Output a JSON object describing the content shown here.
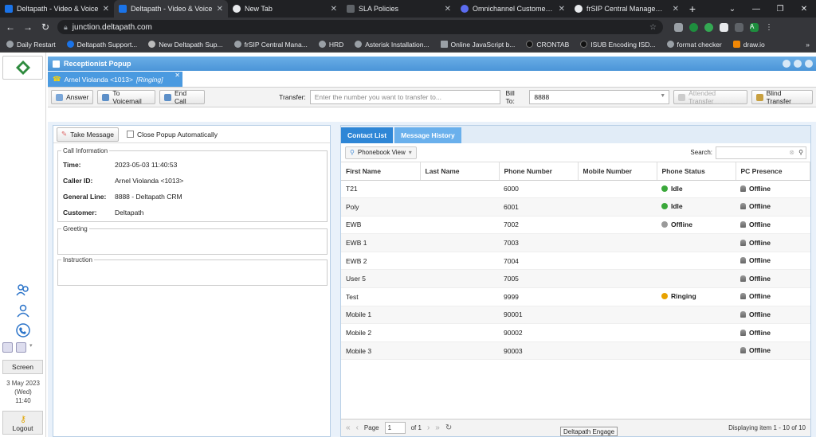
{
  "browser": {
    "tabs": [
      {
        "title": "Deltapath - Video & Voice",
        "active": false
      },
      {
        "title": "Deltapath - Video & Voice",
        "active": true
      },
      {
        "title": "New Tab",
        "active": false
      },
      {
        "title": "SLA Policies",
        "active": false
      },
      {
        "title": "Omnichannel Customer En",
        "active": false
      },
      {
        "title": "frSIP Central Management",
        "active": false
      }
    ],
    "url": "junction.deltapath.com",
    "avatar_letter": "A",
    "bookmarks": [
      "Daily Restart",
      "Deltapath Support...",
      "New Deltapath Sup...",
      "frSIP Central Mana...",
      "HRD",
      "Asterisk Installation...",
      "Online JavaScript b...",
      "CRONTAB",
      "ISUB Encoding ISD...",
      "format checker",
      "draw.io"
    ],
    "bookmark_more": "»"
  },
  "rail": {
    "screen_label": "Screen",
    "date_line1": "3 May 2023",
    "date_line2": "(Wed)",
    "date_line3": "11:40",
    "logout_label": "Logout"
  },
  "popup": {
    "title": "Receptionist Popup",
    "call_tab": {
      "name": "Arnel Violanda <1013>",
      "state": "[Ringing]"
    },
    "toolbar": {
      "answer": "Answer",
      "to_voicemail": "To Voicemail",
      "end_call": "End Call",
      "transfer_label": "Transfer:",
      "transfer_placeholder": "Enter the number you want to transfer to...",
      "bill_to_label": "Bill To:",
      "bill_to_value": "8888",
      "attended_transfer": "Attended Transfer",
      "blind_transfer": "Blind Transfer"
    },
    "left": {
      "take_message": "Take Message",
      "close_auto": "Close Popup Automatically",
      "call_info_legend": "Call Information",
      "rows": [
        {
          "label": "Time:",
          "value": "2023-05-03 11:40:53"
        },
        {
          "label": "Caller ID:",
          "value": "Arnel Violanda <1013>"
        },
        {
          "label": "General Line:",
          "value": "8888 - Deltapath CRM"
        },
        {
          "label": "Customer:",
          "value": "Deltapath"
        }
      ],
      "greeting_legend": "Greeting",
      "instruction_legend": "Instruction"
    },
    "right": {
      "tabs": [
        "Contact List",
        "Message History"
      ],
      "phonebook_view": "Phonebook View",
      "search_label": "Search:",
      "columns": [
        "First Name",
        "Last Name",
        "Phone Number",
        "Mobile Number",
        "Phone Status",
        "PC Presence"
      ],
      "rows": [
        {
          "first": "T21",
          "last": "",
          "phone": "6000",
          "mobile": "",
          "status": "Idle",
          "status_color": "#3aa83a",
          "presence": "Offline"
        },
        {
          "first": "Poly",
          "last": "",
          "phone": "6001",
          "mobile": "",
          "status": "Idle",
          "status_color": "#3aa83a",
          "presence": "Offline"
        },
        {
          "first": "EWB",
          "last": "",
          "phone": "7002",
          "mobile": "",
          "status": "Offline",
          "status_color": "#9a9a9a",
          "presence": "Offline"
        },
        {
          "first": "EWB 1",
          "last": "",
          "phone": "7003",
          "mobile": "",
          "status": "",
          "status_color": "",
          "presence": "Offline"
        },
        {
          "first": "EWB 2",
          "last": "",
          "phone": "7004",
          "mobile": "",
          "status": "",
          "status_color": "",
          "presence": "Offline"
        },
        {
          "first": "User 5",
          "last": "",
          "phone": "7005",
          "mobile": "",
          "status": "",
          "status_color": "",
          "presence": "Offline"
        },
        {
          "first": "Test",
          "last": "",
          "phone": "9999",
          "mobile": "",
          "status": "Ringing",
          "status_color": "#e8a200",
          "presence": "Offline"
        },
        {
          "first": "Mobile 1",
          "last": "",
          "phone": "90001",
          "mobile": "",
          "status": "",
          "status_color": "",
          "presence": "Offline"
        },
        {
          "first": "Mobile 2",
          "last": "",
          "phone": "90002",
          "mobile": "",
          "status": "",
          "status_color": "",
          "presence": "Offline"
        },
        {
          "first": "Mobile 3",
          "last": "",
          "phone": "90003",
          "mobile": "",
          "status": "",
          "status_color": "",
          "presence": "Offline"
        }
      ],
      "pager": {
        "page_label": "Page",
        "page": "1",
        "of_label": "of 1",
        "display": "Displaying item 1 - 10 of 10"
      }
    }
  },
  "tooltip": "Deltapath Engage"
}
